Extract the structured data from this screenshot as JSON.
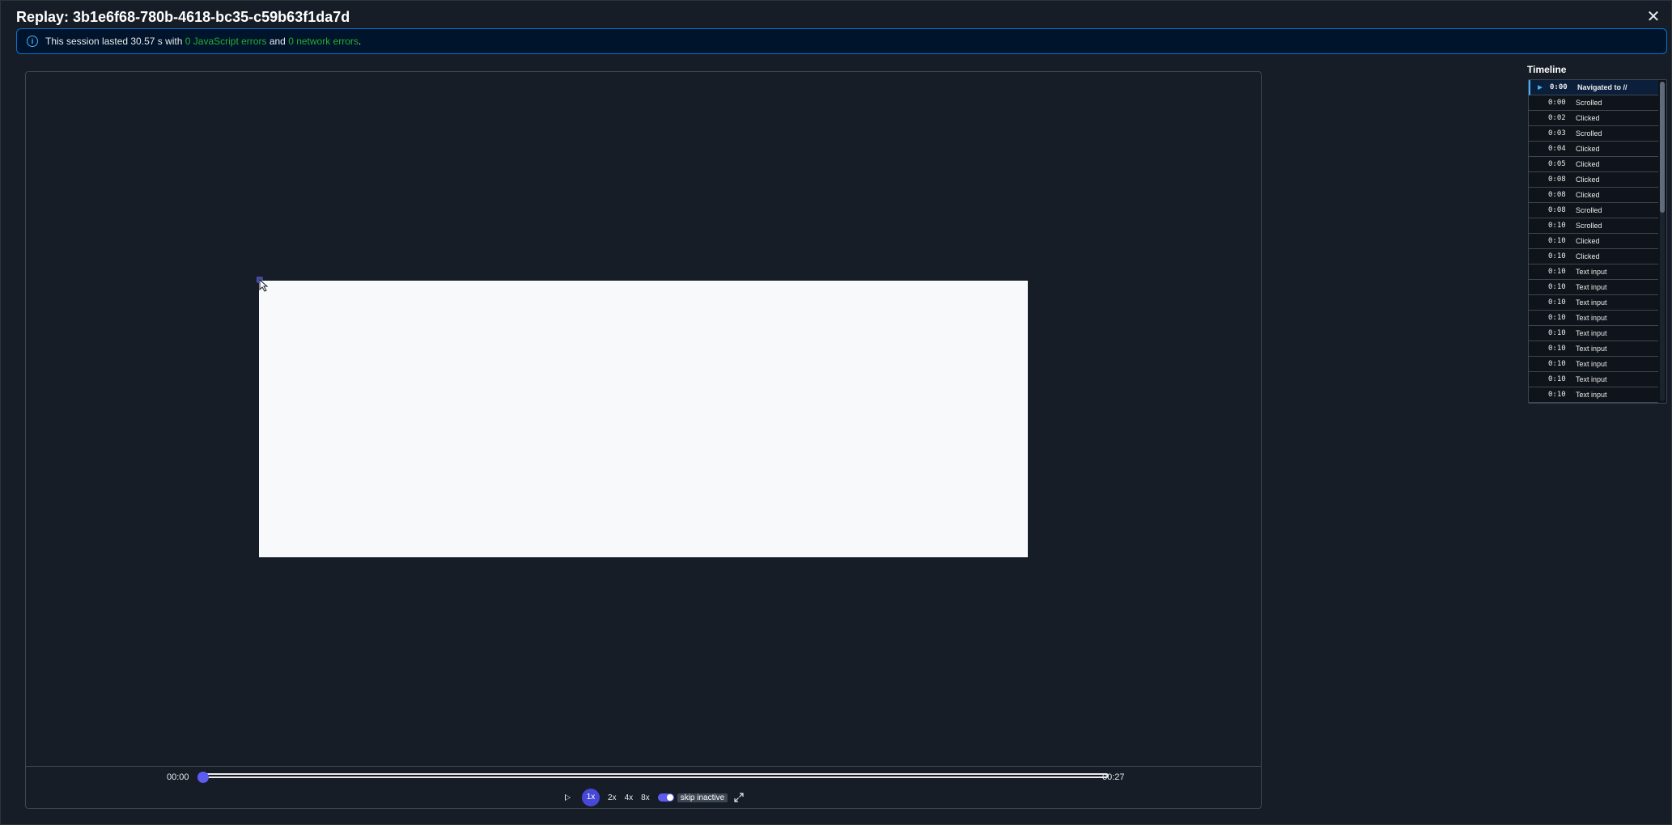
{
  "header": {
    "title": "Replay: 3b1e6f68-780b-4618-bc35-c59b63f1da7d",
    "close_icon": "close-icon"
  },
  "alert": {
    "prefix": "This session lasted 30.57 s with ",
    "js_errors": "0 JavaScript errors",
    "middle": " and ",
    "network_errors": "0 network errors",
    "suffix": "."
  },
  "player": {
    "time_start": "00:00",
    "time_end": "00:27",
    "progress": 0.0,
    "speeds": {
      "s1": "1x",
      "s2": "2x",
      "s4": "4x",
      "s8": "8x"
    },
    "skip_inactive": "skip inactive",
    "skip_inactive_enabled": true
  },
  "timeline": {
    "title": "Timeline",
    "events": [
      {
        "time": "0:00",
        "label": "Navigated to //"
      },
      {
        "time": "0:00",
        "label": "Scrolled"
      },
      {
        "time": "0:02",
        "label": "Clicked"
      },
      {
        "time": "0:03",
        "label": "Scrolled"
      },
      {
        "time": "0:04",
        "label": "Clicked"
      },
      {
        "time": "0:05",
        "label": "Clicked"
      },
      {
        "time": "0:08",
        "label": "Clicked"
      },
      {
        "time": "0:08",
        "label": "Clicked"
      },
      {
        "time": "0:08",
        "label": "Scrolled"
      },
      {
        "time": "0:10",
        "label": "Scrolled"
      },
      {
        "time": "0:10",
        "label": "Clicked"
      },
      {
        "time": "0:10",
        "label": "Clicked"
      },
      {
        "time": "0:10",
        "label": "Text input"
      },
      {
        "time": "0:10",
        "label": "Text input"
      },
      {
        "time": "0:10",
        "label": "Text input"
      },
      {
        "time": "0:10",
        "label": "Text input"
      },
      {
        "time": "0:10",
        "label": "Text input"
      },
      {
        "time": "0:10",
        "label": "Text input"
      },
      {
        "time": "0:10",
        "label": "Text input"
      },
      {
        "time": "0:10",
        "label": "Text input"
      },
      {
        "time": "0:10",
        "label": "Text input"
      }
    ]
  }
}
